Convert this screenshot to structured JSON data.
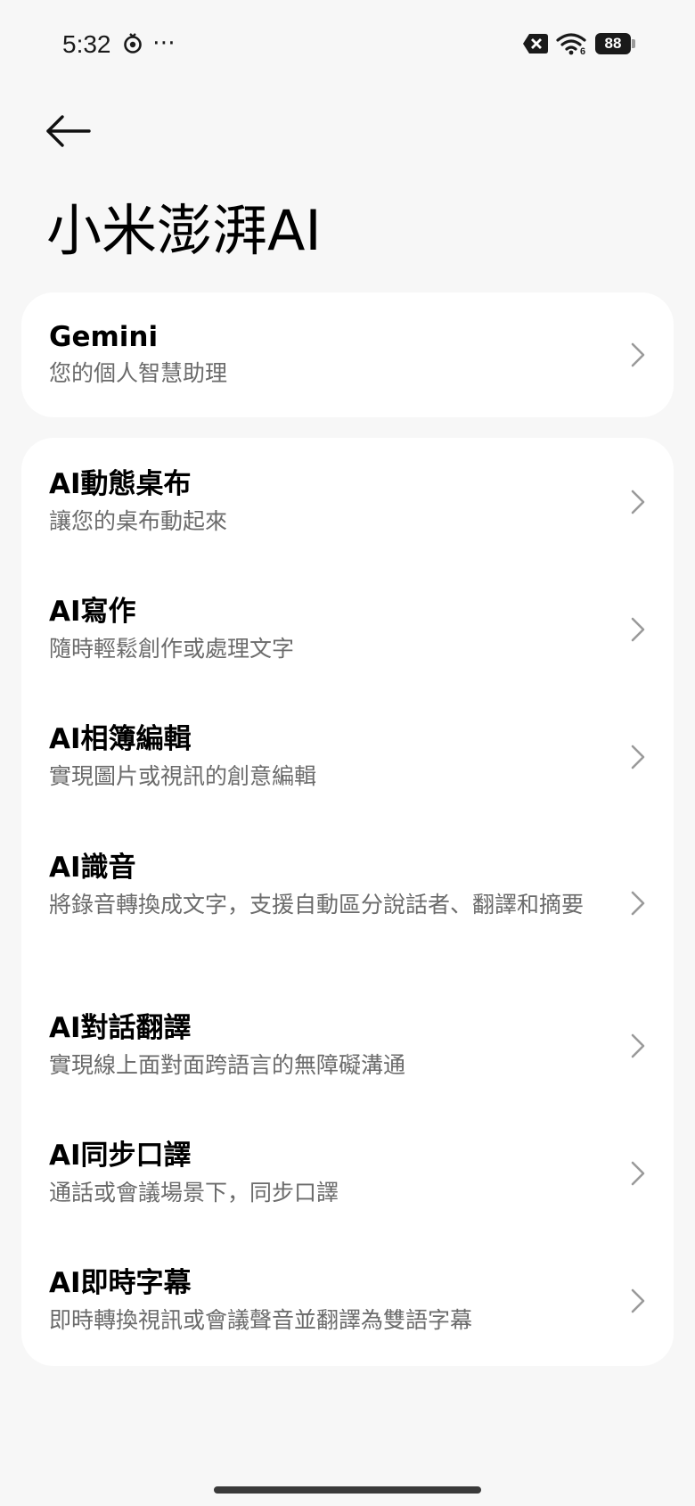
{
  "status_bar": {
    "time": "5:32",
    "more_glyph": "⋯",
    "battery": "88",
    "wifi_badge": "6",
    "icons": [
      "sync-icon",
      "more-icon",
      "close-badge-icon",
      "wifi-icon",
      "battery-icon"
    ]
  },
  "page": {
    "title": "小米澎湃AI"
  },
  "card_1": {
    "items": [
      {
        "title": "Gemini",
        "subtitle": "您的個人智慧助理"
      }
    ]
  },
  "card_2": {
    "items": [
      {
        "title": "AI動態桌布",
        "subtitle": "讓您的桌布動起來"
      },
      {
        "title": "AI寫作",
        "subtitle": "隨時輕鬆創作或處理文字"
      },
      {
        "title": "AI相簿編輯",
        "subtitle": "實現圖片或視訊的創意編輯"
      },
      {
        "title": "AI識音",
        "subtitle": "將錄音轉換成文字，支援自動區分說話者、翻譯和摘要"
      },
      {
        "title": "AI對話翻譯",
        "subtitle": "實現線上面對面跨語言的無障礙溝通"
      },
      {
        "title": "AI同步口譯",
        "subtitle": "通話或會議場景下，同步口譯"
      },
      {
        "title": "AI即時字幕",
        "subtitle": "即時轉換視訊或會議聲音並翻譯為雙語字幕"
      }
    ]
  },
  "colors": {
    "background": "#f7f7f7",
    "card": "#ffffff",
    "title_text": "#000000",
    "subtitle_text": "#6b6b6b",
    "chevron": "#9a9a9a"
  }
}
